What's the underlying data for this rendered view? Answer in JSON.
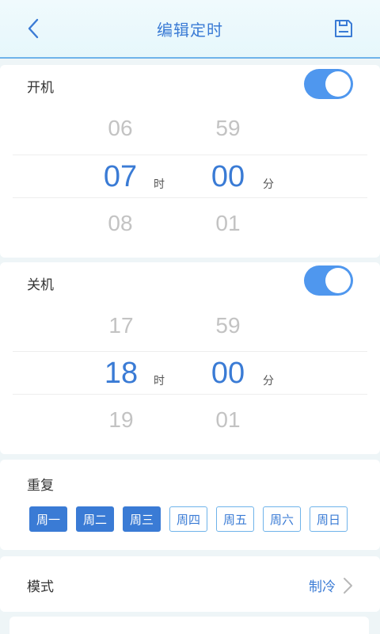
{
  "header": {
    "title": "编辑定时",
    "back_icon": "chevron-left-icon",
    "save_icon": "save-icon"
  },
  "on_timer": {
    "label": "开机",
    "enabled": true,
    "hours": {
      "prev": "06",
      "selected": "07",
      "next": "08",
      "unit": "时"
    },
    "minutes": {
      "prev": "59",
      "selected": "00",
      "next": "01",
      "unit": "分"
    }
  },
  "off_timer": {
    "label": "关机",
    "enabled": true,
    "hours": {
      "prev": "17",
      "selected": "18",
      "next": "19",
      "unit": "时"
    },
    "minutes": {
      "prev": "59",
      "selected": "00",
      "next": "01",
      "unit": "分"
    }
  },
  "repeat": {
    "label": "重复",
    "days": [
      {
        "label": "周一",
        "selected": true
      },
      {
        "label": "周二",
        "selected": true
      },
      {
        "label": "周三",
        "selected": true
      },
      {
        "label": "周四",
        "selected": false
      },
      {
        "label": "周五",
        "selected": false
      },
      {
        "label": "周六",
        "selected": false
      },
      {
        "label": "周日",
        "selected": false
      }
    ]
  },
  "mode": {
    "label": "模式",
    "value": "制冷"
  },
  "colors": {
    "accent": "#3a7bd5",
    "toggle": "#4f97ee",
    "outline": "#6fb3ea"
  }
}
